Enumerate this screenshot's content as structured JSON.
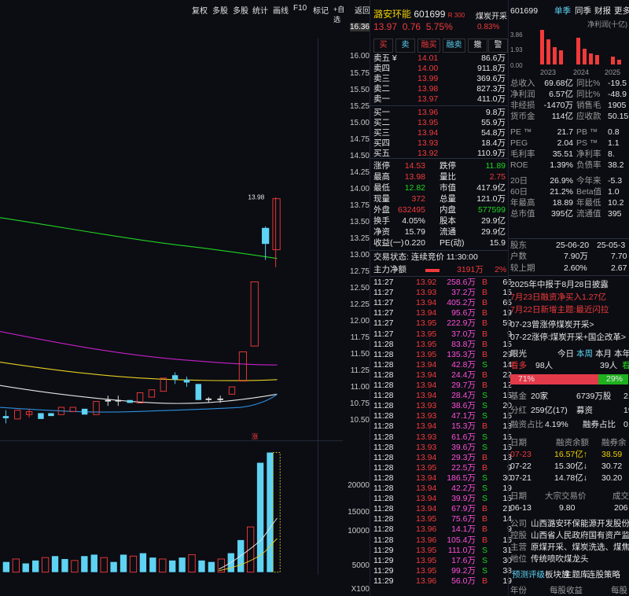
{
  "toolbar": {
    "items": [
      "复权",
      "多股",
      "多股",
      "统计",
      "画线",
      "F10",
      "标记",
      "+自选",
      "返回"
    ]
  },
  "chart": {
    "price_labels": [
      "16.36",
      "16.00",
      "15.75",
      "15.50",
      "15.25",
      "15.00",
      "14.75",
      "14.50",
      "14.25",
      "14.00",
      "13.75",
      "13.50",
      "13.25",
      "13.00",
      "12.75",
      "12.50",
      "12.25",
      "12.00",
      "11.75",
      "11.50",
      "11.25",
      "11.00",
      "10.75",
      "10.50"
    ],
    "high_mark": "13.98",
    "vol_labels": [
      "20000",
      "15000",
      "10000",
      "5000"
    ],
    "vol_unit": "X100",
    "limit_up_mark": "涨"
  },
  "stock": {
    "name": "潞安环能",
    "code": "601699",
    "tag": "R 300",
    "sector": "煤炭开采",
    "price": "13.97",
    "change": "0.76",
    "pct": "5.75%",
    "sector_pct": "0.83%"
  },
  "buttons": [
    "买",
    "卖",
    "融买",
    "融卖",
    "撤",
    "警"
  ],
  "asks": [
    {
      "label": "卖五 ¥",
      "price": "14.01",
      "vol": "86.6万"
    },
    {
      "label": "卖四",
      "price": "14.00",
      "vol": "911.8万"
    },
    {
      "label": "卖三",
      "price": "13.99",
      "vol": "369.6万"
    },
    {
      "label": "卖二",
      "price": "13.98",
      "vol": "827.3万"
    },
    {
      "label": "卖一",
      "price": "13.97",
      "vol": "411.0万"
    }
  ],
  "bids": [
    {
      "label": "买一",
      "price": "13.96",
      "vol": "9.8万"
    },
    {
      "label": "买二",
      "price": "13.95",
      "vol": "55.9万"
    },
    {
      "label": "买三",
      "price": "13.94",
      "vol": "54.8万"
    },
    {
      "label": "买四",
      "price": "13.93",
      "vol": "18.4万"
    },
    {
      "label": "买五",
      "price": "13.92",
      "vol": "110.9万"
    }
  ],
  "stats": [
    {
      "a": "涨停",
      "b": "14.53",
      "c": "跌停",
      "d": "11.89",
      "bc": "red",
      "dc": "green"
    },
    {
      "a": "最高",
      "b": "13.98",
      "c": "量比",
      "d": "2.75",
      "bc": "red",
      "dc": "red"
    },
    {
      "a": "最低",
      "b": "12.82",
      "c": "市值",
      "d": "417.9亿",
      "bc": "green",
      "dc": "white"
    },
    {
      "a": "现量",
      "b": "372",
      "c": "总量",
      "d": "121.0万",
      "bc": "red",
      "dc": "white"
    },
    {
      "a": "外盘",
      "b": "632495",
      "c": "内盘",
      "d": "577599",
      "bc": "red",
      "dc": "green"
    },
    {
      "a": "换手",
      "b": "4.05%",
      "c": "股本",
      "d": "29.9亿",
      "bc": "white",
      "dc": "white"
    },
    {
      "a": "净资",
      "b": "15.79",
      "c": "流通",
      "d": "29.9亿",
      "bc": "white",
      "dc": "white"
    },
    {
      "a": "收益(一)",
      "b": "0.220",
      "c": "PE(动)",
      "d": "15.9",
      "bc": "white",
      "dc": "white"
    }
  ],
  "trade_status": "交易状态: 连续竞价 11:30:00",
  "main_flow": {
    "label": "主力净额",
    "value": "3191万",
    "pct": "2%"
  },
  "ticks": [
    [
      "11:27",
      "13.92",
      "258.6万",
      "B",
      "66",
      "red"
    ],
    [
      "11:27",
      "13.93",
      "37.2万",
      "B",
      "15",
      "red"
    ],
    [
      "11:27",
      "13.94",
      "405.2万",
      "B",
      "65",
      "red"
    ],
    [
      "11:27",
      "13.94",
      "95.6万",
      "B",
      "19",
      "red"
    ],
    [
      "11:27",
      "13.95",
      "222.9万",
      "B",
      "59",
      "red"
    ],
    [
      "11:27",
      "13.95",
      "37.0万",
      "B",
      "9",
      "red"
    ],
    [
      "11:28",
      "13.95",
      "83.8万",
      "B",
      "15",
      "red"
    ],
    [
      "11:28",
      "13.95",
      "135.3万",
      "B",
      "29",
      "red"
    ],
    [
      "11:28",
      "13.94",
      "42.8万",
      "S",
      "14",
      "green"
    ],
    [
      "11:28",
      "13.94",
      "24.4万",
      "B",
      "22",
      "red"
    ],
    [
      "11:28",
      "13.94",
      "29.7万",
      "B",
      "12",
      "red"
    ],
    [
      "11:28",
      "13.94",
      "28.4万",
      "S",
      "15",
      "green"
    ],
    [
      "11:28",
      "13.93",
      "38.6万",
      "S",
      "20",
      "green"
    ],
    [
      "11:28",
      "13.93",
      "47.1万",
      "S",
      "15",
      "green"
    ],
    [
      "11:28",
      "13.94",
      "15.3万",
      "B",
      "13",
      "red"
    ],
    [
      "11:28",
      "13.93",
      "61.6万",
      "S",
      "15",
      "green"
    ],
    [
      "11:28",
      "13.93",
      "39.6万",
      "S",
      "15",
      "green"
    ],
    [
      "11:28",
      "13.94",
      "29.3万",
      "B",
      "13",
      "red"
    ],
    [
      "11:28",
      "13.95",
      "22.5万",
      "B",
      "9",
      "red"
    ],
    [
      "11:28",
      "13.94",
      "186.5万",
      "S",
      "30",
      "green"
    ],
    [
      "11:28",
      "13.94",
      "42.2万",
      "S",
      "19",
      "green"
    ],
    [
      "11:28",
      "13.94",
      "39.9万",
      "S",
      "15",
      "green"
    ],
    [
      "11:28",
      "13.94",
      "67.9万",
      "B",
      "21",
      "red"
    ],
    [
      "11:28",
      "13.95",
      "75.6万",
      "B",
      "14",
      "red"
    ],
    [
      "11:28",
      "13.96",
      "14.1万",
      "B",
      "9",
      "red"
    ],
    [
      "11:28",
      "13.96",
      "105.4万",
      "B",
      "15",
      "red"
    ],
    [
      "11:29",
      "13.95",
      "111.0万",
      "S",
      "31",
      "green"
    ],
    [
      "11:29",
      "13.95",
      "17.6万",
      "S",
      "30",
      "green"
    ],
    [
      "11:29",
      "13.95",
      "99.2万",
      "S",
      "38",
      "green"
    ],
    [
      "11:29",
      "13.96",
      "56.0万",
      "B",
      "19",
      "red"
    ]
  ],
  "right": {
    "code": "601699",
    "tabs": [
      "单季",
      "同季",
      "财报",
      "更多"
    ],
    "chart_title": "净利润(十亿)",
    "bar_vals": [
      "3.86",
      "1.93",
      "0.00"
    ],
    "years": [
      "2023",
      "2024",
      "2025"
    ],
    "fin": [
      [
        "总收入",
        "69.68亿",
        "同比%",
        "-19.5"
      ],
      [
        "净利润",
        "6.57亿",
        "同比%",
        "-48.9"
      ],
      [
        "非经损",
        "-1470万",
        "销售毛",
        "1905"
      ],
      [
        "货币金",
        "114亿",
        "应收款",
        "50.15"
      ],
      [
        "PE ™",
        "21.7",
        "PB ™",
        "0.8"
      ],
      [
        "PEG",
        "2.04",
        "PS ™",
        "1.1"
      ],
      [
        "毛利率",
        "35.51",
        "净利率",
        "8."
      ],
      [
        "ROE",
        "1.39%",
        "负债率",
        "38.2"
      ],
      [
        "20日",
        "26.9%",
        "今年来",
        "-5.3"
      ],
      [
        "60日",
        "21.2%",
        "Beta值",
        "1.0"
      ],
      [
        "年最高",
        "18.89",
        "年最低",
        "10.2"
      ],
      [
        "总市值",
        "395亿",
        "流通值",
        "395"
      ]
    ],
    "holder_hdr": [
      "股东",
      "25-06-20",
      "25-05-3"
    ],
    "holder_rows": [
      [
        "户数",
        "7.90万",
        "7.70"
      ],
      [
        "较上期",
        "2.60%",
        "2.67"
      ]
    ],
    "news": [
      "2025年中报于8月28日披露",
      "7月23日融资净买入1.27亿",
      "7月22日新增主题:最近闪拉",
      "07-23曾涨停煤炭开采>",
      "07-22涨停:煤炭开采+国企改革>"
    ],
    "sentiment": {
      "tab": "眼光",
      "tabs": [
        "今日",
        "本周",
        "本月",
        "本年"
      ],
      "bull": "看多",
      "bull_n": "98人",
      "bear_n": "39人",
      "bear": "看",
      "bull_pct": "71%",
      "bear_pct": "29%"
    },
    "fund": [
      [
        "基金",
        "20家",
        "6739万股",
        "2.2"
      ],
      [
        "分红",
        "259亿(17)",
        "募资",
        "19.80亿"
      ],
      [
        "融资占比",
        "4.19%",
        "融券占比",
        "0.01"
      ]
    ],
    "margin_hdr": [
      "日期",
      "融资余额",
      "融券余"
    ],
    "margin": [
      [
        "07-23",
        "16.57亿↑",
        "38.59"
      ],
      [
        "07-22",
        "15.30亿↓",
        "30.72"
      ],
      [
        "07-21",
        "14.78亿↓",
        "30.20"
      ]
    ],
    "block_hdr": [
      "日期",
      "大宗交易价",
      "成交"
    ],
    "block": [
      [
        "06-13",
        "9.80",
        "206"
      ]
    ],
    "profile": [
      [
        "公司",
        "山西潞安环保能源开发股份"
      ],
      [
        "控股",
        "山西省人民政府国有资产监"
      ],
      [
        "主营",
        "原煤开采、煤炭洗选、煤焦"
      ],
      [
        "地位",
        "传统喷吹煤龙头"
      ]
    ],
    "links": [
      "预测评级",
      "板块族",
      "主题库",
      "连股策略"
    ],
    "bottom": [
      "年份",
      "每股收益",
      "每股"
    ]
  }
}
